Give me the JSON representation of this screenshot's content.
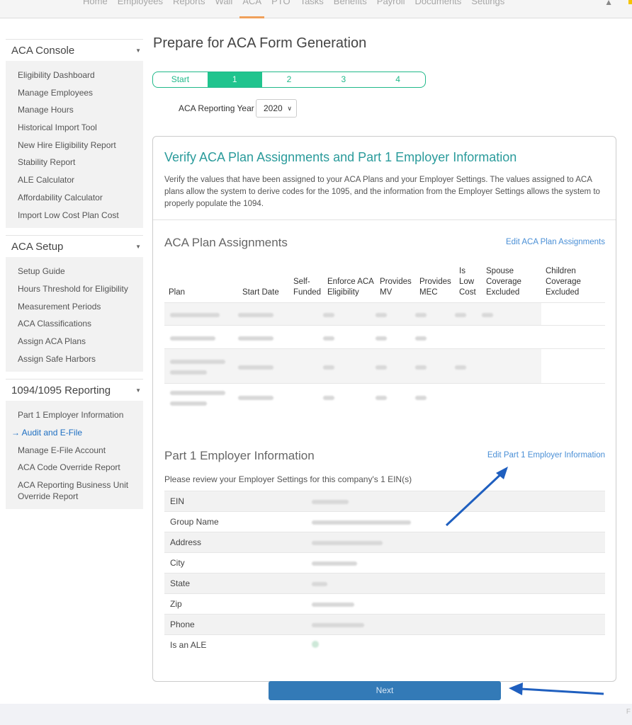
{
  "topnav": {
    "items": [
      "Home",
      "Employees",
      "Reports",
      "Wall",
      "ACA",
      "PTO",
      "Tasks",
      "Benefits",
      "Payroll",
      "Documents",
      "Settings"
    ],
    "active": "ACA",
    "bell_icon": "bell-icon"
  },
  "sidebar": {
    "sections": [
      {
        "title": "ACA Console",
        "items": [
          "Eligibility Dashboard",
          "Manage Employees",
          "Manage Hours",
          "Historical Import Tool",
          "New Hire Eligibility Report",
          "Stability Report",
          "ALE Calculator",
          "Affordability Calculator",
          "Import Low Cost Plan Cost"
        ]
      },
      {
        "title": "ACA Setup",
        "items": [
          "Setup Guide",
          "Hours Threshold for Eligibility",
          "Measurement Periods",
          "ACA Classifications",
          "Assign ACA Plans",
          "Assign Safe Harbors"
        ]
      },
      {
        "title": "1094/1095 Reporting",
        "items": [
          "Part 1 Employer Information",
          "Audit and E-File",
          "Manage E-File Account",
          "ACA Code Override Report",
          "ACA Reporting Business Unit Override Report"
        ],
        "active": "Audit and E-File"
      }
    ]
  },
  "main": {
    "title": "Prepare for ACA Form Generation",
    "steps": [
      "Start",
      "1",
      "2",
      "3",
      "4"
    ],
    "active_step": "1",
    "year_label": "ACA Reporting Year",
    "year_value": "2020"
  },
  "panel": {
    "title": "Verify ACA Plan Assignments and Part 1 Employer Information",
    "description": "Verify the values that have been assigned to your ACA Plans and your Employer Settings. The values assigned to ACA plans allow the system to derive codes for the 1095, and the information from the Employer Settings allows the system to properly populate the 1094.",
    "plans": {
      "title": "ACA Plan Assignments",
      "edit_link": "Edit ACA Plan Assignments",
      "headers": [
        "Plan",
        "Start Date",
        "Self-Funded",
        "Enforce ACA Eligibility",
        "Provides MV",
        "Provides MEC",
        "Is Low Cost",
        "Spouse Coverage Excluded",
        "Children Coverage Excluded"
      ]
    },
    "employer": {
      "title": "Part 1 Employer Information",
      "edit_link": "Edit Part 1 Employer Information",
      "description": "Please review your Employer Settings for this company's 1 EIN(s)",
      "rows": [
        "EIN",
        "Group Name",
        "Address",
        "City",
        "State",
        "Zip",
        "Phone",
        "Is an ALE"
      ]
    }
  },
  "next_label": "Next",
  "colors": {
    "accent_teal": "#2a9b9b",
    "step_green": "#20c48e",
    "link_blue": "#4a8fd6",
    "button_blue": "#337ab7",
    "annotation_arrow": "#1f5fbf"
  }
}
